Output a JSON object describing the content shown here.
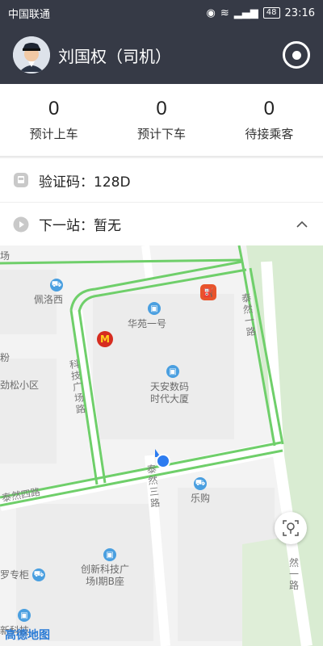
{
  "status": {
    "carrier": "中国联通",
    "battery": "48",
    "time": "23:16"
  },
  "header": {
    "driver_name": "刘国权（司机）"
  },
  "stats": [
    {
      "value": "0",
      "label": "预计上车"
    },
    {
      "value": "0",
      "label": "预计下车"
    },
    {
      "value": "0",
      "label": "待接乘客"
    }
  ],
  "info": {
    "code": "验证码：128D",
    "next_stop": "下一站：暂无"
  },
  "map": {
    "pois": {
      "peiluoxi": "佩洛西",
      "huayuan": "华苑一号",
      "tianan": "天安数码\n时代大厦",
      "lego": "乐购",
      "chuangxin": "创新科技广\n场I期B座",
      "songxiaoqu": "劲松小区",
      "luozhuangui": "罗专柜",
      "xinke": "新科技",
      "fen": "粉",
      "chang": "场"
    },
    "roads": {
      "kejiguangchang": "科技广场路",
      "tairan1": "泰然一路",
      "tairan3": "泰然三路",
      "tairan4": "泰然四路",
      "tairan1b": "然一路"
    },
    "logo": "高德地图"
  },
  "colors": {
    "header_bg": "#363a46",
    "route_green": "#6fcf6a",
    "location_blue": "#2d7cf0"
  }
}
